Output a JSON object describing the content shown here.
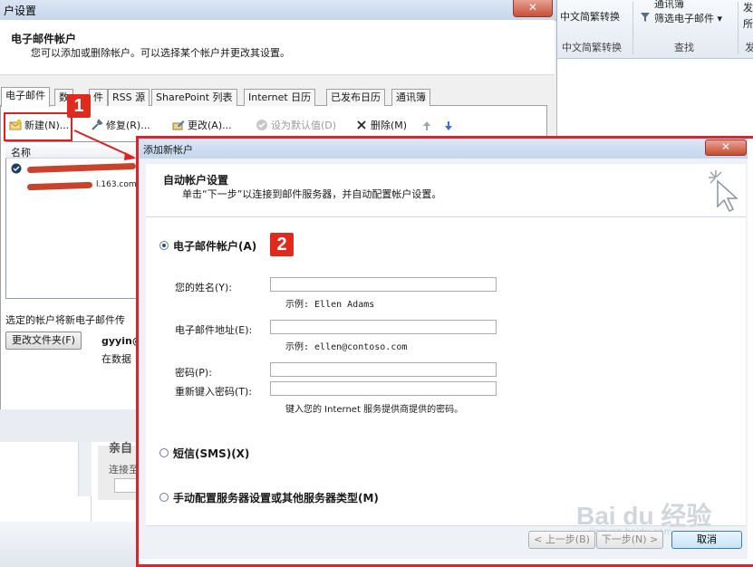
{
  "background_window": {
    "title": "户设置",
    "header_title": "电子邮件帐户",
    "header_desc": "您可以添加或删除帐户。可以选择某个帐户并更改其设置。",
    "tabs": [
      {
        "label": "电子邮件"
      },
      {
        "label": "数"
      },
      {
        "label": "件"
      },
      {
        "label": "RSS 源"
      },
      {
        "label": "SharePoint 列表"
      },
      {
        "label": "Internet 日历"
      },
      {
        "label": "已发布日历"
      },
      {
        "label": "通讯簿"
      }
    ],
    "toolbar": {
      "new_label": "新建(N)...",
      "repair_label": "修复(R)...",
      "change_label": "更改(A)...",
      "default_label": "设为默认值(D)",
      "delete_label": "删除(M)"
    },
    "list_header": "名称",
    "account_fragment": "l.163.com",
    "note": "选定的帐户将新电子邮件传",
    "change_folder_label": "更改文件夹(F)",
    "account_fragment2": "gyyin@",
    "account_fragment3": "在数据"
  },
  "ribbon": {
    "item1": "中文简繁转换",
    "item2": "筛选电子邮件",
    "item3": "通讯簿",
    "group1": "中文简繁转换",
    "group2": "查找",
    "item4": "发",
    "item5": "所",
    "group3": "发"
  },
  "lower_left": {
    "text1": "亲自",
    "text2": "连接至"
  },
  "markers": {
    "one": "1",
    "two": "2"
  },
  "dialog": {
    "title": "添加新帐户",
    "header_title": "自动帐户设置",
    "header_desc": "单击“下一步”以连接到邮件服务器，并自动配置帐户设置。",
    "options": {
      "email": "电子邮件帐户(A)",
      "sms": "短信(SMS)(X)",
      "manual": "手动配置服务器设置或其他服务器类型(M)"
    },
    "fields": {
      "name_label": "您的姓名(Y):",
      "name_hint": "示例: Ellen Adams",
      "email_label": "电子邮件地址(E):",
      "email_hint": "示例: ellen@contoso.com",
      "password_label": "密码(P):",
      "password2_label": "重新键入密码(T):",
      "password_hint": "键入您的 Internet 服务提供商提供的密码。"
    },
    "buttons": {
      "back": "< 上一步(B)",
      "next": "下一步(N) >",
      "cancel": "取消"
    }
  },
  "watermark": {
    "text": "Bai du 经验",
    "sub": "jingyan.baidu.com"
  }
}
